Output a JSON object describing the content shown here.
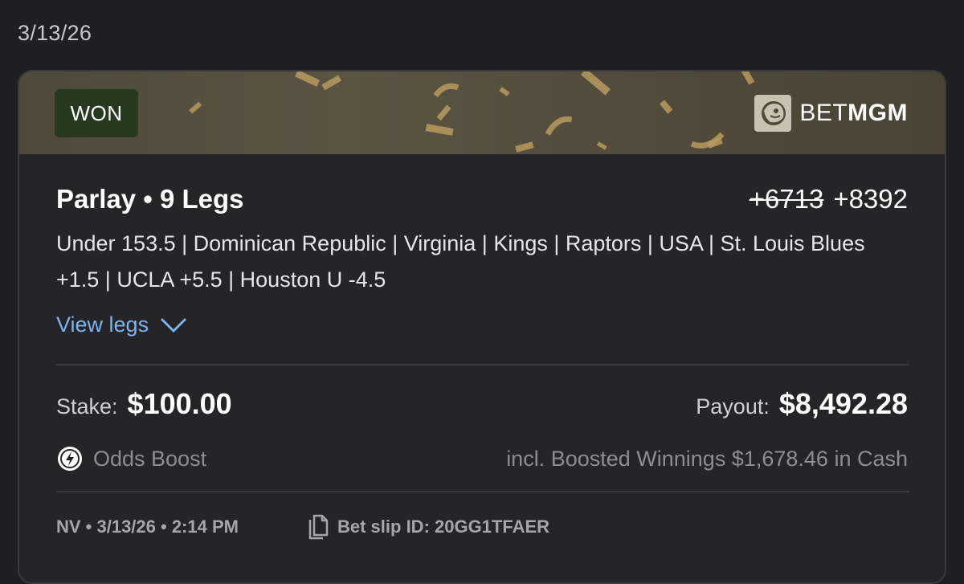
{
  "date_header": "3/13/26",
  "bet": {
    "status": "WON",
    "brand": {
      "prefix": "BET",
      "suffix": "MGM",
      "logo_icon": "lion-icon"
    },
    "title": "Parlay • 9 Legs",
    "odds_original": "+6713",
    "odds_boosted": "+8392",
    "legs_summary": "Under 153.5 | Dominican Republic | Virginia | Kings | Raptors | USA | St. Louis Blues +1.5 | UCLA +5.5 | Houston U -4.5",
    "view_legs_label": "View legs",
    "stake_label": "Stake:",
    "stake_value": "$100.00",
    "payout_label": "Payout:",
    "payout_value": "$8,492.28",
    "boost_label": "Odds Boost",
    "boost_note": "incl. Boosted Winnings $1,678.46 in Cash",
    "meta": "NV • 3/13/26 • 2:14 PM",
    "slip_id": "Bet slip ID: 20GG1TFAER"
  },
  "colors": {
    "won_badge_bg": "#253a1f",
    "link": "#7bb3f0",
    "confetti_gold": "#b89a5e"
  }
}
